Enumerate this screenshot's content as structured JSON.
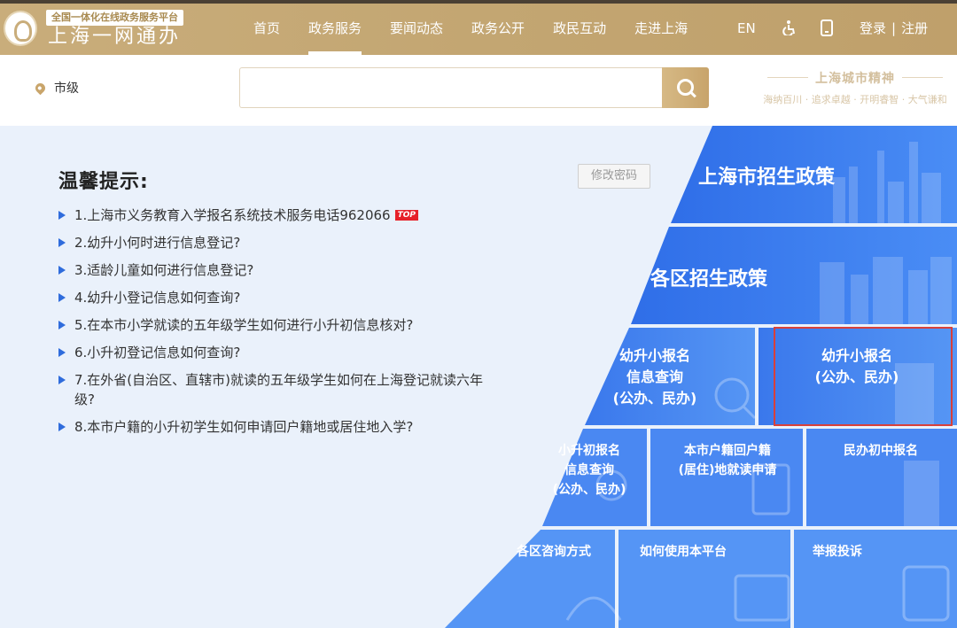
{
  "header": {
    "brand_sub": "全国一体化在线政务服务平台",
    "brand_main": "上海一网通办",
    "nav": [
      {
        "label": "首页",
        "active": false
      },
      {
        "label": "政务服务",
        "active": true
      },
      {
        "label": "要闻动态",
        "active": false
      },
      {
        "label": "政务公开",
        "active": false
      },
      {
        "label": "政民互动",
        "active": false
      },
      {
        "label": "走进上海",
        "active": false
      }
    ],
    "lang": "EN",
    "login": "登录",
    "register": "注册",
    "login_sep": "|"
  },
  "search": {
    "location": "市级",
    "placeholder": "",
    "spirit_title": "上海城市精神",
    "spirit_sub": "海纳百川 · 追求卓越 · 开明睿智 · 大气谦和"
  },
  "tips": {
    "title": "温馨提示:",
    "change_password": "修改密码",
    "top_badge": "TOP",
    "items": [
      "1.上海市义务教育入学报名系统技术服务电话962066",
      "2.幼升小何时进行信息登记?",
      "3.适龄儿童如何进行信息登记?",
      "4.幼升小登记信息如何查询?",
      "5.在本市小学就读的五年级学生如何进行小升初信息核对?",
      "6.小升初登记信息如何查询?",
      "7.在外省(自治区、直辖市)就读的五年级学生如何在上海登记就读六年级?",
      "8.本市户籍的小升初学生如何申请回户籍地或居住地入学?"
    ]
  },
  "tiles": {
    "city_policy": "上海市招生政策",
    "district_policy": "各区招生政策",
    "primary_query": [
      "幼升小报名",
      "信息查询",
      "(公办、民办)"
    ],
    "primary_apply": [
      "幼升小报名",
      "(公办、民办)"
    ],
    "middle_query": [
      "小升初报名",
      "信息查询",
      "(公办、民办)"
    ],
    "hukou_return": [
      "本市户籍回户籍",
      "(居住)地就读申请"
    ],
    "private_middle": "民办初中报名",
    "district_contact": "各区咨询方式",
    "how_to_use": "如何使用本平台",
    "report": "举报投诉"
  },
  "colors": {
    "header_gold": "#c5a672",
    "tile_blue": "#3d7cf0",
    "accent_red": "#d8403a"
  }
}
